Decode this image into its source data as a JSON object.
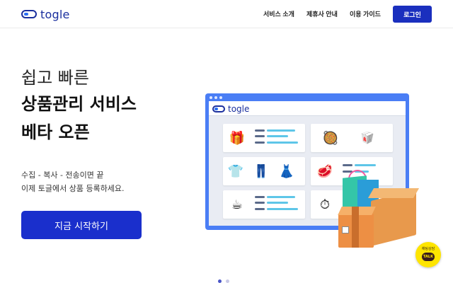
{
  "header": {
    "logo_text": "togle",
    "nav": [
      "서비스 소개",
      "제휴사 안내",
      "이용 가이드"
    ],
    "login_label": "로그인"
  },
  "hero": {
    "line1": "쉽고 빠른",
    "line2": "상품관리 서비스",
    "line3": "베타 오픈",
    "sub1": "수집 - 복사 - 전송이면 끝",
    "sub2": "이제 토글에서 상품 등록하세요.",
    "cta_label": "지금 시작하기"
  },
  "mockup": {
    "logo_text": "togle",
    "products": [
      {
        "icon": "gift-icon",
        "glyph": "🎁"
      },
      {
        "icon": "groceries-icon",
        "glyph": "🥘"
      },
      {
        "icon": "clothes-icon",
        "glyph": "👕"
      },
      {
        "icon": "meat-icon",
        "glyph": "🥩"
      },
      {
        "icon": "coffee-icon",
        "glyph": "☕"
      },
      {
        "icon": "stopwatch-icon",
        "glyph": "⏱"
      }
    ]
  },
  "chat": {
    "label": "채팅상담",
    "bubble": "TALK"
  },
  "colors": {
    "brand": "#1a2f9e",
    "cta": "#1a2fcc",
    "mockup_frame": "#4a7ef5",
    "chat": "#fee500"
  }
}
